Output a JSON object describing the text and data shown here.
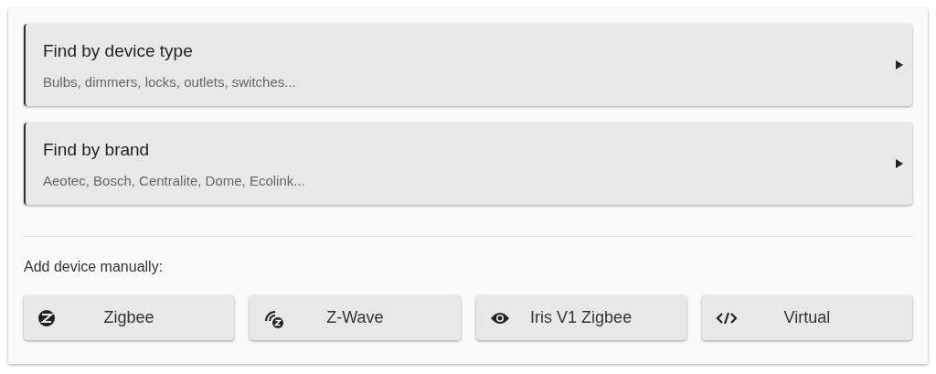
{
  "finders": [
    {
      "title": "Find by device type",
      "subtitle": "Bulbs, dimmers, locks, outlets, switches..."
    },
    {
      "title": "Find by brand",
      "subtitle": "Aeotec, Bosch, Centralite, Dome, Ecolink..."
    }
  ],
  "manual": {
    "label": "Add device manually:",
    "buttons": [
      {
        "label": "Zigbee",
        "kind": "zigbee"
      },
      {
        "label": "Z-Wave",
        "kind": "zwave"
      },
      {
        "label": "Iris V1 Zigbee",
        "kind": "iris"
      },
      {
        "label": "Virtual",
        "kind": "virtual"
      }
    ]
  }
}
